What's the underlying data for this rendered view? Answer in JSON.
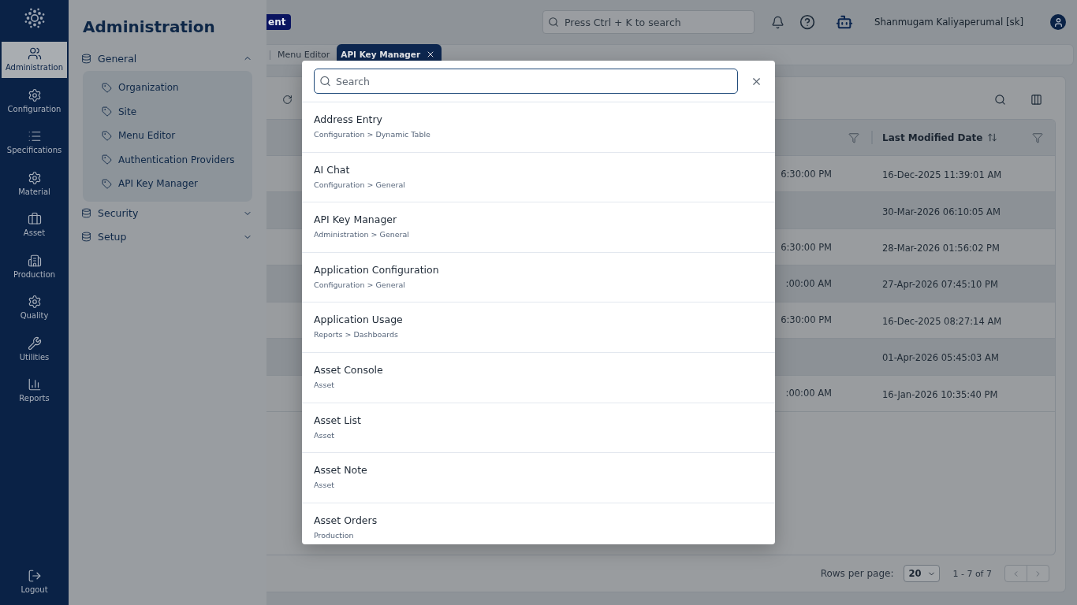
{
  "rail": {
    "items": [
      {
        "label": "Administration",
        "selected": true
      },
      {
        "label": "Configuration",
        "selected": false
      },
      {
        "label": "Specifications",
        "selected": false
      },
      {
        "label": "Material",
        "selected": false
      },
      {
        "label": "Asset",
        "selected": false
      },
      {
        "label": "Production",
        "selected": false
      },
      {
        "label": "Quality",
        "selected": false
      },
      {
        "label": "Utilities",
        "selected": false
      },
      {
        "label": "Reports",
        "selected": false
      }
    ],
    "logout": "Logout"
  },
  "panel": {
    "title": "Administration",
    "sections": [
      {
        "label": "General",
        "expanded": true,
        "children": [
          {
            "label": "Organization"
          },
          {
            "label": "Site"
          },
          {
            "label": "Menu Editor"
          },
          {
            "label": "Authentication Providers"
          },
          {
            "label": "API Key Manager"
          }
        ]
      },
      {
        "label": "Security",
        "expanded": false
      },
      {
        "label": "Setup",
        "expanded": false
      }
    ]
  },
  "header": {
    "badge": "ent",
    "search": {
      "placeholder": "Press Ctrl + K to search"
    },
    "user": "Shanmugam Kaliyaperumal [sk]"
  },
  "tabs": [
    {
      "label": "Menu Editor",
      "selected": false
    },
    {
      "label": "API Key Manager",
      "selected": true
    }
  ],
  "table": {
    "columns": [
      {
        "label": "Last Modified Date"
      }
    ],
    "rows": [
      {
        "column_1": "6:30:00 PM",
        "last_modified_date": "16-Dec-2025 11:39:01 AM"
      },
      {
        "last_modified_date": "30-Mar-2026 06:10:05 AM"
      },
      {
        "column_1": "6:30:00 PM",
        "last_modified_date": "28-Mar-2026 01:56:02 PM"
      },
      {
        "column_1": ":00:00 AM",
        "last_modified_date": "27-Apr-2026 07:45:10 PM"
      },
      {
        "column_1": "6:30:00 PM",
        "last_modified_date": "16-Dec-2025 08:27:14 AM"
      },
      {
        "last_modified_date": "01-Apr-2026 05:45:03 AM"
      },
      {
        "column_1": ":00:00 AM",
        "last_modified_date": "16-Jan-2026 10:35:40 PM"
      }
    ]
  },
  "pagination": {
    "label": "Rows per page:",
    "rows_per_page": "20",
    "range": "1 - 7 of 7"
  },
  "search_dialog": {
    "search": {
      "placeholder": "Search"
    },
    "results": [
      {
        "title": "Address Entry",
        "path": "Configuration > Dynamic Table"
      },
      {
        "title": "AI Chat",
        "path": "Configuration > General"
      },
      {
        "title": "API Key Manager",
        "path": "Administration > General"
      },
      {
        "title": "Application Configuration",
        "path": "Configuration > General"
      },
      {
        "title": "Application Usage",
        "path": "Reports > Dashboards"
      },
      {
        "title": "Asset Console",
        "path": "Asset"
      },
      {
        "title": "Asset List",
        "path": "Asset"
      },
      {
        "title": "Asset Note",
        "path": "Asset"
      },
      {
        "title": "Asset Orders",
        "path": "Production"
      }
    ]
  }
}
